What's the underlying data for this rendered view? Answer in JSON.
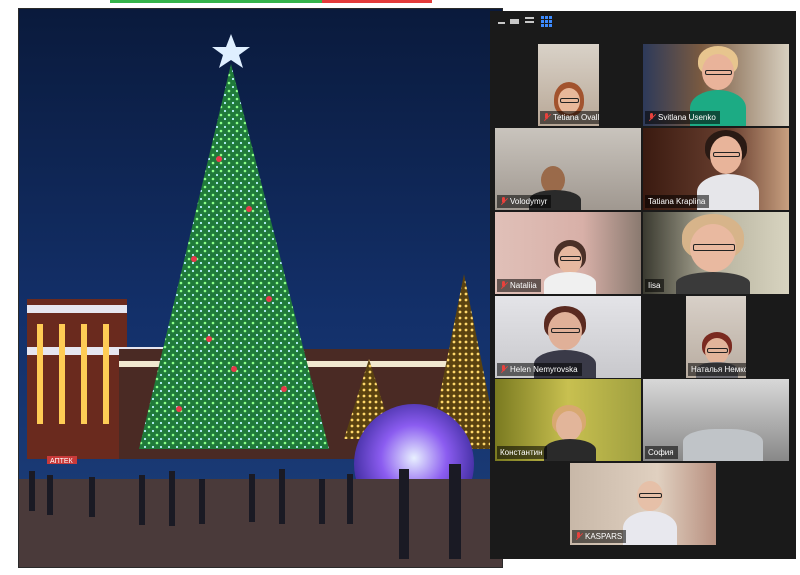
{
  "window": {
    "title": ""
  },
  "toolbar": {
    "minimize_icon": "minimize-icon",
    "view_icons": [
      "speaker-view-icon",
      "list-view-icon",
      "gallery-view-icon"
    ],
    "accent": "#3d8bff"
  },
  "participants": [
    {
      "name": "Tetiana Ovall",
      "muted": true
    },
    {
      "name": "Svitlana Usenko",
      "muted": true
    },
    {
      "name": "Volodymyr",
      "muted": true
    },
    {
      "name": "Tatiana Kraplina",
      "muted": false
    },
    {
      "name": "Nataliia",
      "muted": true
    },
    {
      "name": "Iisa",
      "muted": false,
      "active_speaker": true
    },
    {
      "name": "Helen Nemyrovska",
      "muted": true
    },
    {
      "name": "Наталья Немко",
      "muted": false
    },
    {
      "name": "Константин",
      "muted": false
    },
    {
      "name": "София",
      "muted": false
    },
    {
      "name": "KASPARS",
      "muted": true
    }
  ],
  "shared_photo": {
    "sign_text": "АПТЕК"
  },
  "colors": {
    "active_speaker_border": "#f4d03f",
    "muted_mic": "#e8413c",
    "gallery_bg": "#1a1a1a"
  }
}
